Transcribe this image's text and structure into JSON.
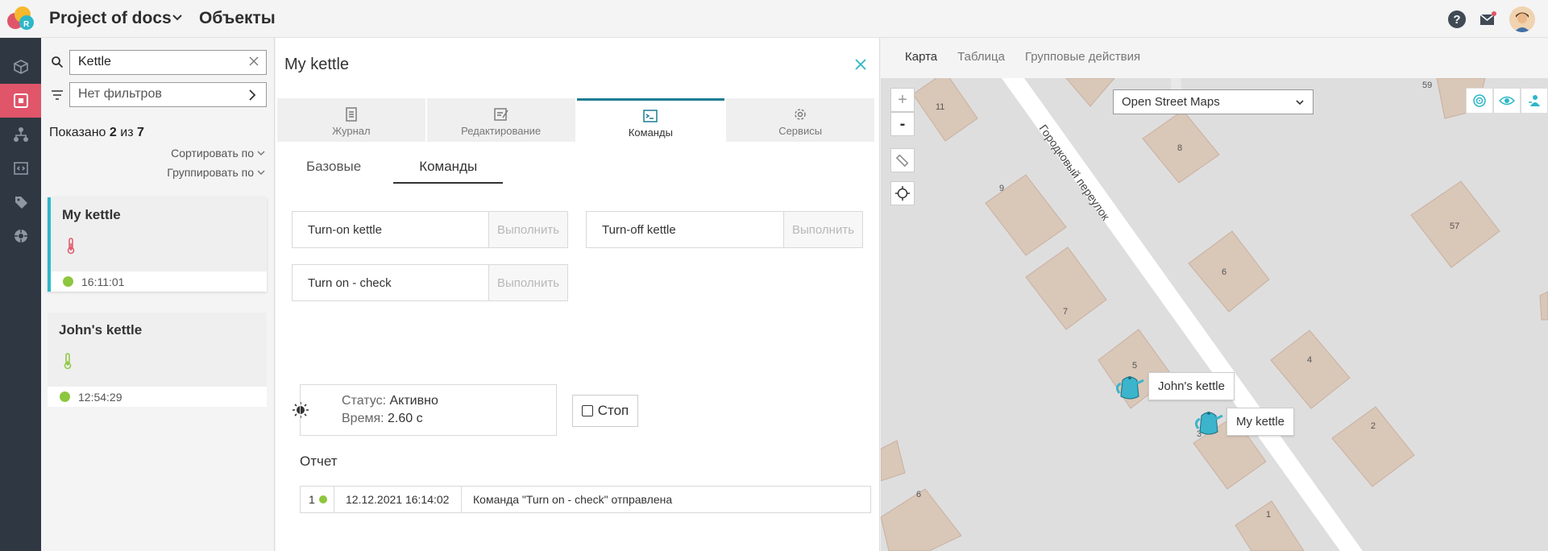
{
  "header": {
    "project_name": "Project of docs",
    "section_title": "Объекты"
  },
  "rail": {
    "items": [
      "objects-icon",
      "monitoring-icon",
      "hierarchy-icon",
      "code-icon",
      "tags-icon",
      "integrations-icon"
    ],
    "active_index": 1,
    "active_color": "#e0556a"
  },
  "list": {
    "search_value": "Kettle",
    "filter_value": "Нет фильтров",
    "shown_prefix": "Показано",
    "shown_count": "2",
    "shown_of": "из",
    "shown_total": "7",
    "sort_label": "Сортировать по",
    "group_label": "Группировать по",
    "cards": [
      {
        "title": "My kettle",
        "time": "16:11:01",
        "selected": true,
        "thermo_color": "#e0556a"
      },
      {
        "title": "John's kettle",
        "time": "12:54:29",
        "selected": false,
        "thermo_color": "#8dc63f"
      }
    ]
  },
  "detail": {
    "title": "My kettle",
    "tabs": [
      {
        "label": "Журнал",
        "icon": "journal-icon"
      },
      {
        "label": "Редактирование",
        "icon": "edit-icon"
      },
      {
        "label": "Команды",
        "icon": "terminal-icon",
        "active": true
      },
      {
        "label": "Сервисы",
        "icon": "services-gear-icon"
      }
    ],
    "subtabs": [
      {
        "label": "Базовые"
      },
      {
        "label": "Команды",
        "active": true
      }
    ],
    "commands": [
      {
        "name": "Turn-on kettle",
        "exec": "Выполнить"
      },
      {
        "name": "Turn-off kettle",
        "exec": "Выполнить"
      },
      {
        "name": "Turn on - check",
        "exec": "Выполнить"
      }
    ],
    "status": {
      "status_label": "Статус:",
      "status_value": "Активно",
      "time_label": "Время:",
      "time_value": "2.60 с"
    },
    "stop_label": "Стоп",
    "report_label": "Отчет",
    "report_rows": [
      {
        "num": "1",
        "date": "12.12.2021 16:14:02",
        "message": "Команда \"Turn on - check\" отправлена"
      }
    ]
  },
  "map": {
    "tabs": [
      {
        "label": "Карта",
        "active": true
      },
      {
        "label": "Таблица"
      },
      {
        "label": "Групповые действия"
      }
    ],
    "layer": "Open Street Maps",
    "zoom_in": "+",
    "zoom_out": "-",
    "street_name": "Городковый переулок",
    "house_numbers": [
      "11",
      "59",
      "8",
      "9",
      "57",
      "6",
      "7",
      "5",
      "4",
      "2",
      "3",
      "6",
      "1"
    ],
    "markers": [
      {
        "label": "John's kettle"
      },
      {
        "label": "My kettle"
      }
    ],
    "colors": {
      "accent": "#2db7c9",
      "marker": "#3bb4cc",
      "building": "#d9c7b8",
      "road": "#ffffff"
    }
  }
}
